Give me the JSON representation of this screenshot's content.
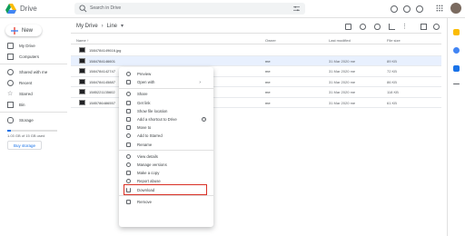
{
  "header": {
    "brand": "Drive",
    "search_placeholder": "Search in Drive"
  },
  "sidebar": {
    "new_label": "New",
    "items": [
      {
        "label": "My Drive",
        "icon": "my-drive-icon"
      },
      {
        "label": "Computers",
        "icon": "computer-icon"
      },
      {
        "label": "Shared with me",
        "icon": "shared-icon"
      },
      {
        "label": "Recent",
        "icon": "clock-icon"
      },
      {
        "label": "Starred",
        "icon": "star-icon"
      },
      {
        "label": "Bin",
        "icon": "bin-icon"
      }
    ],
    "storage_label": "Storage",
    "storage_text": "1.03 GB of 15 GB used",
    "storage_fraction": 0.07,
    "buy_label": "Buy storage"
  },
  "toolbar": {
    "crumb_root": "My Drive",
    "crumb_sep": "›",
    "crumb_current": "Line",
    "crumb_dropdown": "▾"
  },
  "columns": {
    "name": "Name ↑",
    "owner": "Owner",
    "modified": "Last modified",
    "size": "File size"
  },
  "files": [
    {
      "name": "1584784149616.jpg",
      "owner": "",
      "modified": "",
      "size": ""
    },
    {
      "name": "1584784146601",
      "owner": "me",
      "modified": "31 Mar 2020 me",
      "size": "89 KB"
    },
    {
      "name": "1584784142747",
      "owner": "me",
      "modified": "31 Mar 2020 me",
      "size": "72 KB"
    },
    {
      "name": "1584784145887",
      "owner": "me",
      "modified": "31 Mar 2020 me",
      "size": "86 KB"
    },
    {
      "name": "1585221135602",
      "owner": "me",
      "modified": "31 Mar 2020 me",
      "size": "118 KB"
    },
    {
      "name": "1585786486557",
      "owner": "me",
      "modified": "31 Mar 2020 me",
      "size": "61 KB"
    }
  ],
  "menu": {
    "groups": [
      [
        {
          "label": "Preview",
          "icon": "preview-icon"
        },
        {
          "label": "Open with",
          "icon": "open-with-icon",
          "chevron": "›"
        }
      ],
      [
        {
          "label": "Share",
          "icon": "share-icon"
        },
        {
          "label": "Get link",
          "icon": "link-icon"
        },
        {
          "label": "Show file location",
          "icon": "folder-icon"
        },
        {
          "label": "Add a shortcut to Drive",
          "icon": "shortcut-icon",
          "help": "?"
        },
        {
          "label": "Move to",
          "icon": "move-icon"
        },
        {
          "label": "Add to Starred",
          "icon": "star-icon"
        },
        {
          "label": "Rename",
          "icon": "rename-icon"
        }
      ],
      [
        {
          "label": "View details",
          "icon": "info-icon"
        },
        {
          "label": "Manage versions",
          "icon": "versions-icon"
        },
        {
          "label": "Make a copy",
          "icon": "copy-icon"
        },
        {
          "label": "Report abuse",
          "icon": "report-icon"
        },
        {
          "label": "Download",
          "icon": "download-icon",
          "highlight": true
        }
      ],
      [
        {
          "label": "Remove",
          "icon": "trash-icon"
        }
      ]
    ]
  },
  "colors": {
    "accent": "#1a73e8",
    "selected_row": "#e8f0fe",
    "highlight_outline": "#d93025"
  }
}
